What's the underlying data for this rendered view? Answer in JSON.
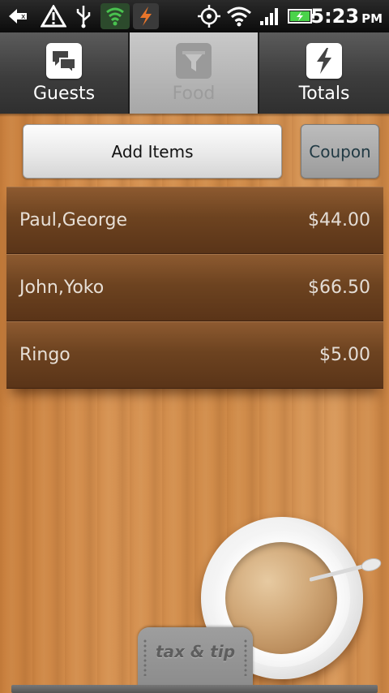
{
  "status_bar": {
    "time": "5:23",
    "ampm": "PM",
    "icons": [
      "back-icon",
      "warning-icon",
      "usb-icon",
      "lookout-shield-icon",
      "app-flash-icon",
      "gps-icon",
      "wifi-icon",
      "signal-icon",
      "battery-icon"
    ],
    "shield_color": "#3aa34a"
  },
  "tabs": [
    {
      "label": "Guests",
      "icon": "chat-bubbles-icon",
      "active": false
    },
    {
      "label": "Food",
      "icon": "funnel-icon",
      "active": true
    },
    {
      "label": "Totals",
      "icon": "lightning-icon",
      "active": false
    }
  ],
  "actions": {
    "add_items_label": "Add Items",
    "coupon_label": "Coupon"
  },
  "items": [
    {
      "name": "Paul,George",
      "amount": "$44.00"
    },
    {
      "name": "John,Yoko",
      "amount": "$66.50"
    },
    {
      "name": "Ringo",
      "amount": "$5.00"
    }
  ],
  "tax_tip_label": "tax & tip"
}
